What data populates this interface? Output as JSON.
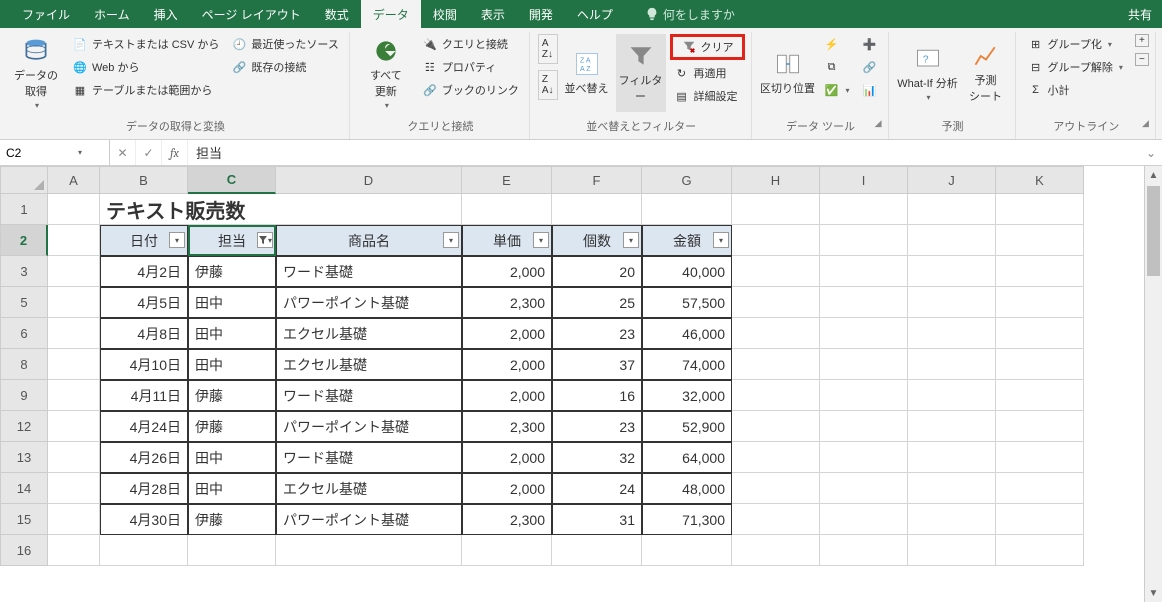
{
  "tabs": [
    "ファイル",
    "ホーム",
    "挿入",
    "ページ レイアウト",
    "数式",
    "データ",
    "校閲",
    "表示",
    "開発",
    "ヘルプ"
  ],
  "active_tab": "データ",
  "tell_me": "何をしますか",
  "share": "共有",
  "ribbon": {
    "g1": {
      "big": "データの\n取得",
      "items": [
        "テキストまたは CSV から",
        "Web から",
        "テーブルまたは範囲から",
        "最近使ったソース",
        "既存の接続"
      ],
      "label": "データの取得と変換"
    },
    "g2": {
      "big": "すべて\n更新",
      "items": [
        "クエリと接続",
        "プロパティ",
        "ブックのリンク"
      ],
      "label": "クエリと接続"
    },
    "g3": {
      "sort": "並べ替え",
      "filter": "フィルター",
      "clear": "クリア",
      "reapply": "再適用",
      "advanced": "詳細設定",
      "label": "並べ替えとフィルター"
    },
    "g4": {
      "big": "区切り位置",
      "label": "データ ツール"
    },
    "g5": {
      "whatif": "What-If 分析",
      "forecast": "予測\nシート",
      "label": "予測"
    },
    "g6": {
      "items": [
        "グループ化",
        "グループ解除",
        "小計"
      ],
      "label": "アウトライン"
    }
  },
  "namebox": "C2",
  "formula": "担当",
  "cols": [
    "A",
    "B",
    "C",
    "D",
    "E",
    "F",
    "G",
    "H",
    "I",
    "J",
    "K"
  ],
  "row_numbers": [
    "1",
    "2",
    "3",
    "5",
    "6",
    "8",
    "9",
    "12",
    "13",
    "14",
    "15",
    "16"
  ],
  "selected_cell": {
    "col": "C",
    "row": "2"
  },
  "table": {
    "title": "テキスト販売数",
    "headers": [
      "日付",
      "担当",
      "商品名",
      "単価",
      "個数",
      "金額"
    ],
    "filtered_col": 1,
    "rows": [
      [
        "4月2日",
        "伊藤",
        "ワード基礎",
        "2,000",
        "20",
        "40,000"
      ],
      [
        "4月5日",
        "田中",
        "パワーポイント基礎",
        "2,300",
        "25",
        "57,500"
      ],
      [
        "4月8日",
        "田中",
        "エクセル基礎",
        "2,000",
        "23",
        "46,000"
      ],
      [
        "4月10日",
        "田中",
        "エクセル基礎",
        "2,000",
        "37",
        "74,000"
      ],
      [
        "4月11日",
        "伊藤",
        "ワード基礎",
        "2,000",
        "16",
        "32,000"
      ],
      [
        "4月24日",
        "伊藤",
        "パワーポイント基礎",
        "2,300",
        "23",
        "52,900"
      ],
      [
        "4月26日",
        "田中",
        "ワード基礎",
        "2,000",
        "32",
        "64,000"
      ],
      [
        "4月28日",
        "田中",
        "エクセル基礎",
        "2,000",
        "24",
        "48,000"
      ],
      [
        "4月30日",
        "伊藤",
        "パワーポイント基礎",
        "2,300",
        "31",
        "71,300"
      ]
    ]
  }
}
